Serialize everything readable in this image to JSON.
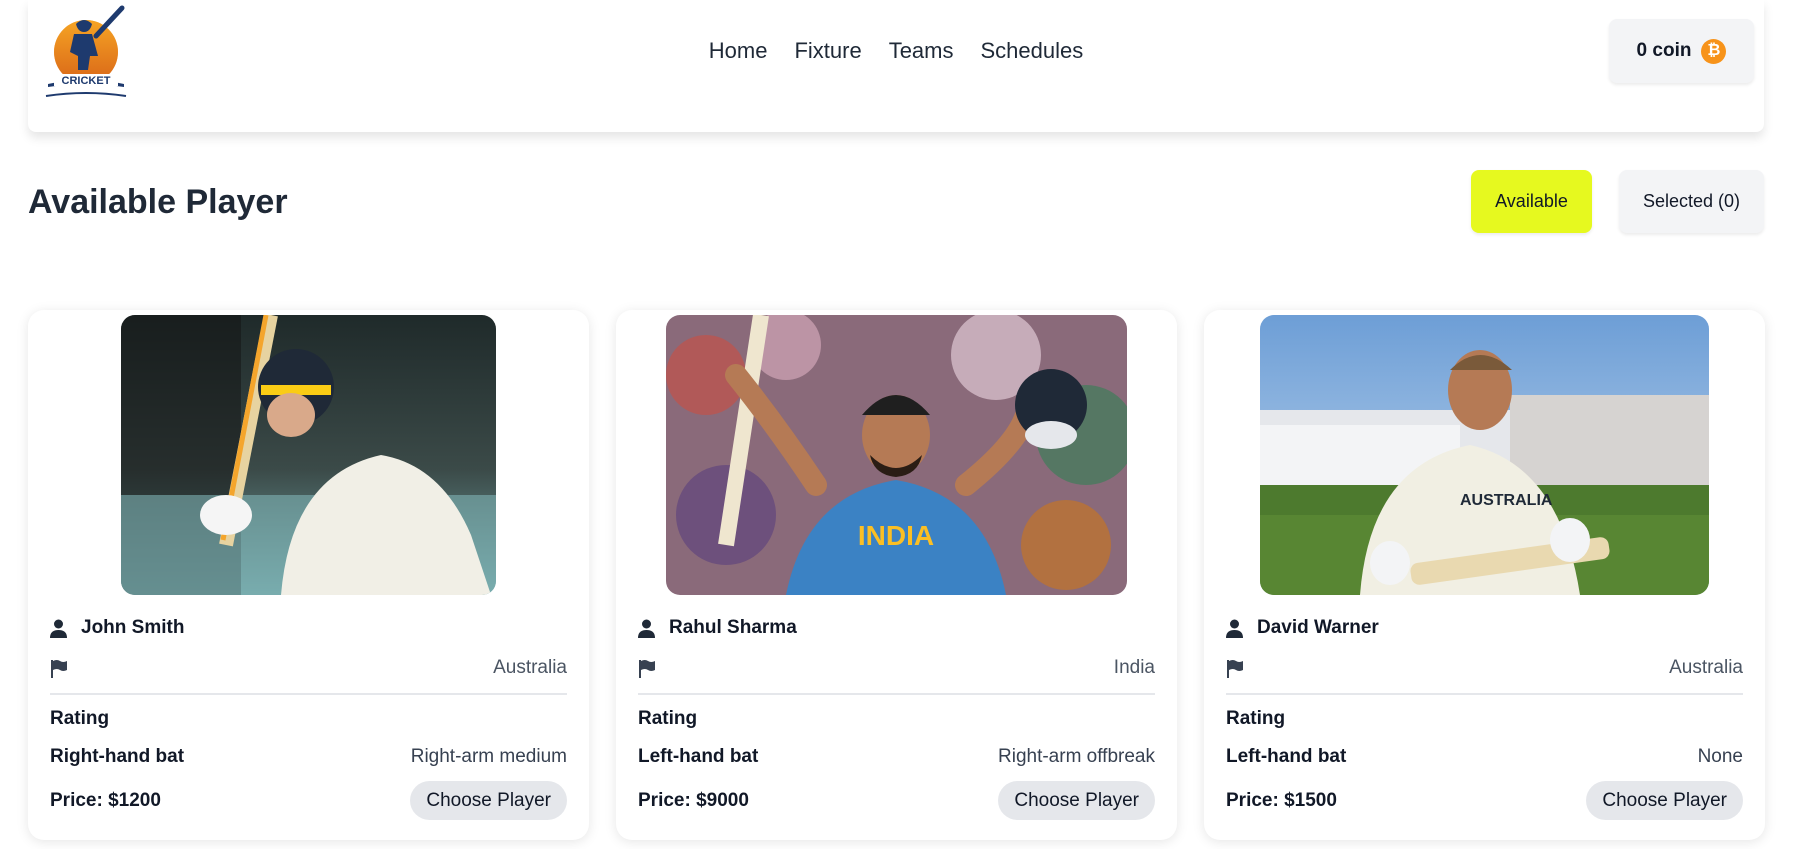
{
  "navbar": {
    "logo_text": "CRICKET",
    "links": [
      "Home",
      "Fixture",
      "Teams",
      "Schedules"
    ],
    "coin_label": "0 coin",
    "coin_icon": "bitcoin-icon"
  },
  "page": {
    "title": "Available Player",
    "tabs": {
      "available": "Available",
      "selected": "Selected (0)"
    }
  },
  "colors": {
    "accent": "#e6f91f",
    "coin": "#f7931a",
    "text": "#111827"
  },
  "players": [
    {
      "name": "John Smith",
      "country": "Australia",
      "rating_label": "Rating",
      "batting": "Right-hand bat",
      "bowling": "Right-arm medium",
      "price": "Price: $1200",
      "button": "Choose Player"
    },
    {
      "name": "Rahul Sharma",
      "country": "India",
      "rating_label": "Rating",
      "batting": "Left-hand bat",
      "bowling": "Right-arm offbreak",
      "price": "Price: $9000",
      "button": "Choose Player"
    },
    {
      "name": "David Warner",
      "country": "Australia",
      "rating_label": "Rating",
      "batting": "Left-hand bat",
      "bowling": "None",
      "price": "Price: $1500",
      "button": "Choose Player"
    }
  ]
}
